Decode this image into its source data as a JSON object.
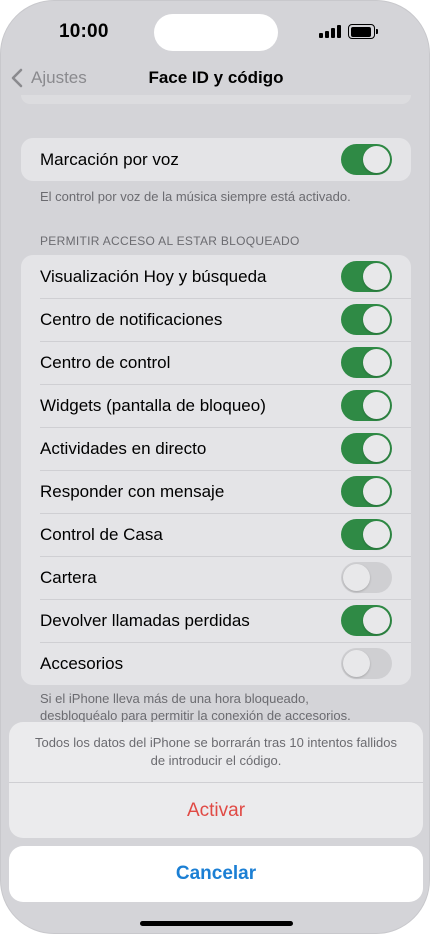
{
  "status_bar": {
    "time": "10:00"
  },
  "nav": {
    "back_label": "Ajustes",
    "title": "Face ID y código"
  },
  "voice_dial": {
    "label": "Marcación por voz",
    "enabled": true,
    "footnote": "El control por voz de la música siempre está activado."
  },
  "locked_access": {
    "header": "PERMITIR ACCESO AL ESTAR BLOQUEADO",
    "items": [
      {
        "label": "Visualización Hoy y búsqueda",
        "enabled": true
      },
      {
        "label": "Centro de notificaciones",
        "enabled": true
      },
      {
        "label": "Centro de control",
        "enabled": true
      },
      {
        "label": "Widgets (pantalla de bloqueo)",
        "enabled": true
      },
      {
        "label": "Actividades en directo",
        "enabled": true
      },
      {
        "label": "Responder con mensaje",
        "enabled": true
      },
      {
        "label": "Control de Casa",
        "enabled": true
      },
      {
        "label": "Cartera",
        "enabled": false
      },
      {
        "label": "Devolver llamadas perdidas",
        "enabled": true
      },
      {
        "label": "Accesorios",
        "enabled": false
      }
    ],
    "footnote_line1": "Si el iPhone lleva más de una hora bloqueado,",
    "footnote_line2": "desbloquéalo para permitir la conexión de accesorios."
  },
  "action_sheet": {
    "message": "Todos los datos del iPhone se borrarán tras 10 intentos fallidos de introducir el código.",
    "action_label": "Activar",
    "cancel_label": "Cancelar"
  },
  "colors": {
    "toggle_on": "#2f8a45",
    "toggle_off": "#cfcfd2",
    "destructive": "#e04a45",
    "link_blue": "#1b7fd4"
  }
}
